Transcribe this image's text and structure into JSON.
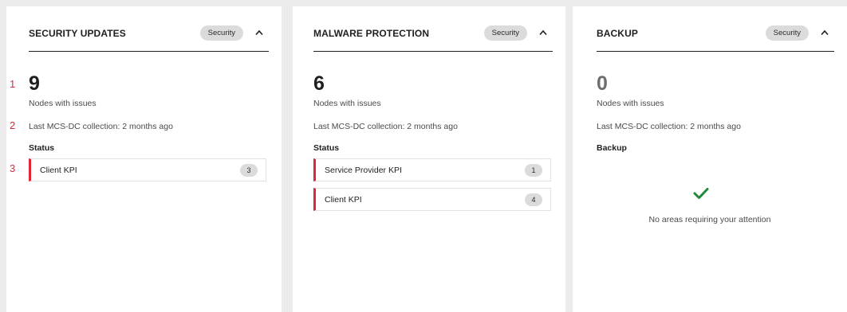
{
  "panels": [
    {
      "title": "SECURITY UPDATES",
      "badge": "Security",
      "count": "9",
      "count_label": "Nodes with issues",
      "collection": "Last MCS-DC collection: 2 months ago",
      "section": "Status",
      "items": [
        {
          "label": "Client KPI",
          "count": "3"
        }
      ]
    },
    {
      "title": "MALWARE PROTECTION",
      "badge": "Security",
      "count": "6",
      "count_label": "Nodes with issues",
      "collection": "Last MCS-DC collection: 2 months ago",
      "section": "Status",
      "items": [
        {
          "label": "Service Provider KPI",
          "count": "1"
        },
        {
          "label": "Client KPI",
          "count": "4"
        }
      ]
    },
    {
      "title": "BACKUP",
      "badge": "Security",
      "count": "0",
      "count_label": "Nodes with issues",
      "collection": "Last MCS-DC collection: 2 months ago",
      "section": "Backup",
      "empty_message": "No areas requiring your attention"
    }
  ],
  "annotations": [
    "1",
    "2",
    "3"
  ],
  "colors": {
    "accent_red": "#e1263a",
    "check_green": "#1f8a3b",
    "badge_bg": "#dbdbdb"
  },
  "icons": {
    "collapse": "chevron-up-icon",
    "ok": "checkmark-icon"
  }
}
